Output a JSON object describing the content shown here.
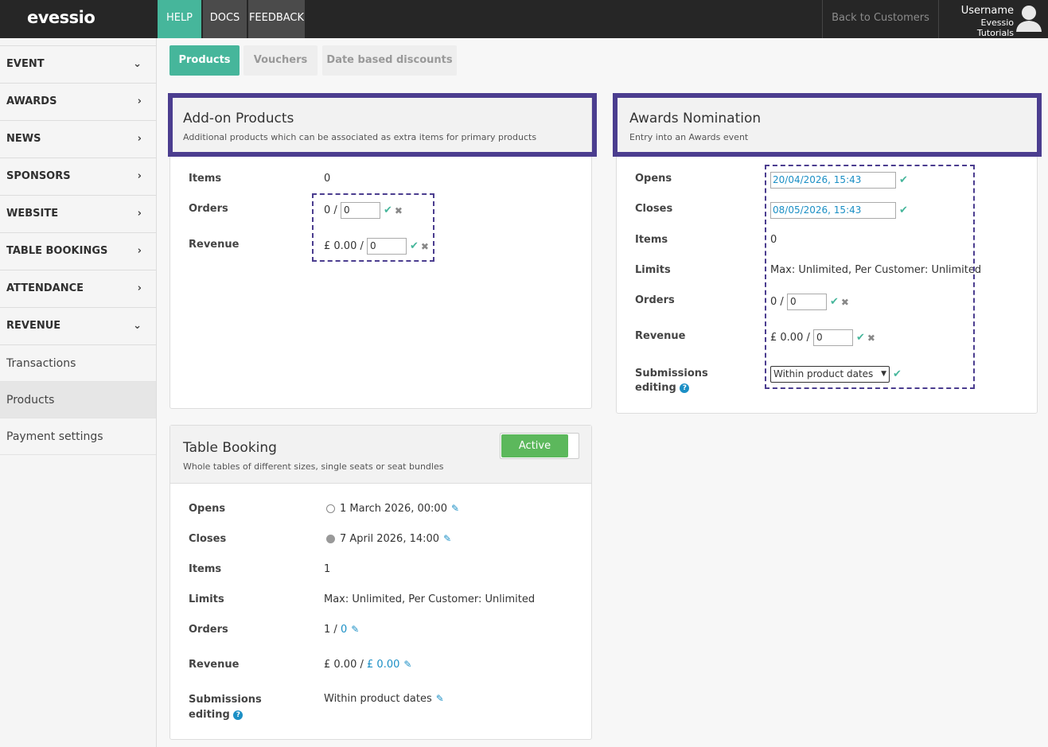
{
  "header": {
    "logo": "evessio",
    "nav": {
      "help": "HELP",
      "docs": "DOCS",
      "feedback": "FEEDBACK"
    },
    "back_label": "Back to Customers",
    "user_name": "Username",
    "org_name": "Evessio Tutorials"
  },
  "sidebar": {
    "items": [
      {
        "label": "EVENT",
        "chevron": "v"
      },
      {
        "label": "AWARDS",
        "chevron": ">"
      },
      {
        "label": "NEWS",
        "chevron": ">"
      },
      {
        "label": "SPONSORS",
        "chevron": ">"
      },
      {
        "label": "WEBSITE",
        "chevron": ">"
      },
      {
        "label": "TABLE BOOKINGS",
        "chevron": ">"
      },
      {
        "label": "ATTENDANCE",
        "chevron": ">"
      },
      {
        "label": "REVENUE",
        "chevron": "v"
      }
    ],
    "sub": [
      {
        "label": "Transactions"
      },
      {
        "label": "Products"
      },
      {
        "label": "Payment settings"
      }
    ]
  },
  "tabs": {
    "products": "Products",
    "vouchers": "Vouchers",
    "discounts": "Date based discounts"
  },
  "addon": {
    "title": "Add-on Products",
    "desc": "Additional products which can be associated as extra items for primary products",
    "items_label": "Items",
    "items_value": "0",
    "orders_label": "Orders",
    "orders_prefix": "0 /",
    "orders_input": "0",
    "revenue_label": "Revenue",
    "revenue_prefix": "£ 0.00 /",
    "revenue_input": "0"
  },
  "awards": {
    "title": "Awards Nomination",
    "desc": "Entry into an Awards event",
    "opens_label": "Opens",
    "opens_value": "20/04/2026, 15:43",
    "closes_label": "Closes",
    "closes_value": "08/05/2026, 15:43",
    "items_label": "Items",
    "items_value": "0",
    "limits_label": "Limits",
    "limits_value": "Max: Unlimited, Per Customer: Unlimited",
    "orders_label": "Orders",
    "orders_prefix": "0 /",
    "orders_input": "0",
    "revenue_label": "Revenue",
    "revenue_prefix": "£ 0.00 /",
    "revenue_input": "0",
    "sub_label_1": "Submissions",
    "sub_label_2": "editing",
    "sub_select": "Within product dates"
  },
  "table": {
    "title": "Table Booking",
    "desc": "Whole tables of different sizes, single seats or seat bundles",
    "status": "Active",
    "opens_label": "Opens",
    "opens_value": "1 March 2026, 00:00",
    "closes_label": "Closes",
    "closes_value": "7 April 2026, 14:00",
    "items_label": "Items",
    "items_value": "1",
    "limits_label": "Limits",
    "limits_value": "Max: Unlimited, Per Customer: Unlimited",
    "orders_label": "Orders",
    "orders_a": "1 /",
    "orders_b": "0",
    "revenue_label": "Revenue",
    "revenue_a": "£ 0.00 /",
    "revenue_b": "£ 0.00",
    "sub_label_1": "Submissions",
    "sub_label_2": "editing",
    "sub_value": "Within product dates"
  },
  "colors": {
    "accent": "#46b69b",
    "highlight": "#4b3d8f",
    "link": "#1b8fc5",
    "active": "#5cb85c"
  }
}
